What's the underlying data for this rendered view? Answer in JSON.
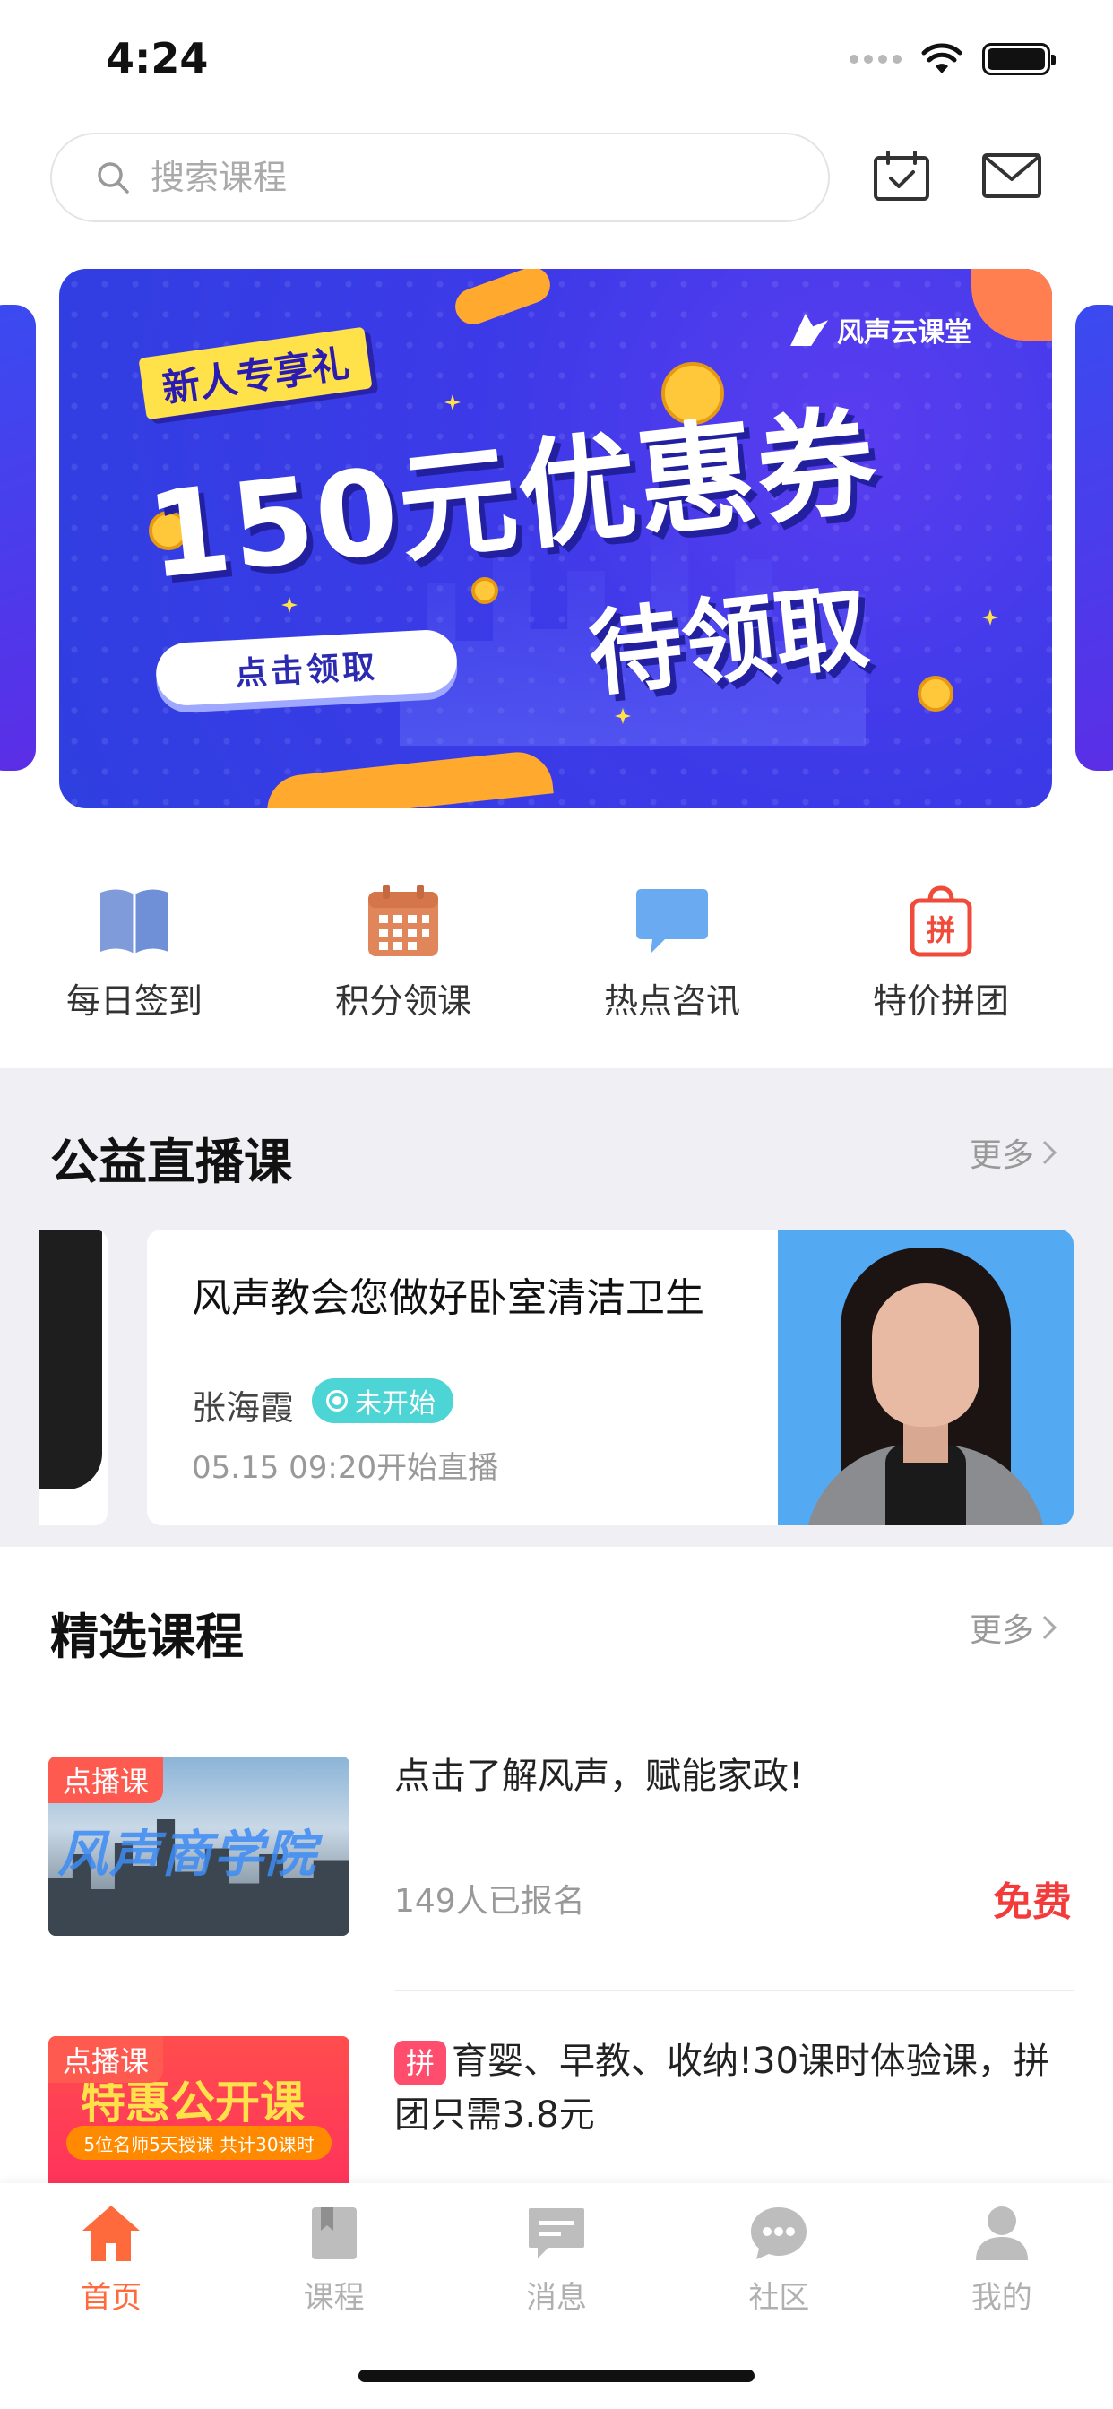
{
  "status": {
    "time": "4:24"
  },
  "search": {
    "placeholder": "搜索课程"
  },
  "banner": {
    "brand": "风声云课堂",
    "tag": "新人专享礼",
    "title": "150元优惠券",
    "subtitle": "待领取",
    "button": "点击领取"
  },
  "quick_nav": [
    {
      "label": "每日签到",
      "icon": "book-icon",
      "color": "#6f8fd6"
    },
    {
      "label": "积分领课",
      "icon": "calendar-grid-icon",
      "color": "#e0865a"
    },
    {
      "label": "热点咨讯",
      "icon": "chat-bubble-icon",
      "color": "#6aaaf0"
    },
    {
      "label": "特价拼团",
      "icon": "group-buy-bag-icon",
      "color": "#f04a3a"
    }
  ],
  "live": {
    "title": "公益直播课",
    "more": "更多",
    "card": {
      "title": "风声教会您做好卧室清洁卫生",
      "teacher": "张海霞",
      "status": "未开始",
      "time": "05.15 09:20开始直播"
    }
  },
  "courses": {
    "title": "精选课程",
    "more": "更多",
    "items": [
      {
        "badge": "点播课",
        "thumb_text": "风声商学院",
        "title": "点击了解风声，赋能家政!",
        "enrolled": "149人已报名",
        "price": "免费"
      },
      {
        "badge": "点播课",
        "pin": "拼",
        "thumb_text": "特惠公开课",
        "thumb_sub": "5位名师5天授课 共计30课时",
        "title": "育婴、早教、收纳!30课时体验课，拼团只需3.8元"
      }
    ]
  },
  "tabs": [
    {
      "label": "首页",
      "icon": "home-icon",
      "active": true
    },
    {
      "label": "课程",
      "icon": "course-book-icon",
      "active": false
    },
    {
      "label": "消息",
      "icon": "message-icon",
      "active": false
    },
    {
      "label": "社区",
      "icon": "community-icon",
      "active": false
    },
    {
      "label": "我的",
      "icon": "profile-icon",
      "active": false
    }
  ],
  "colors": {
    "accent": "#ff6a3d",
    "price": "#f43b3b",
    "live_badge": "#4dd4d4"
  }
}
